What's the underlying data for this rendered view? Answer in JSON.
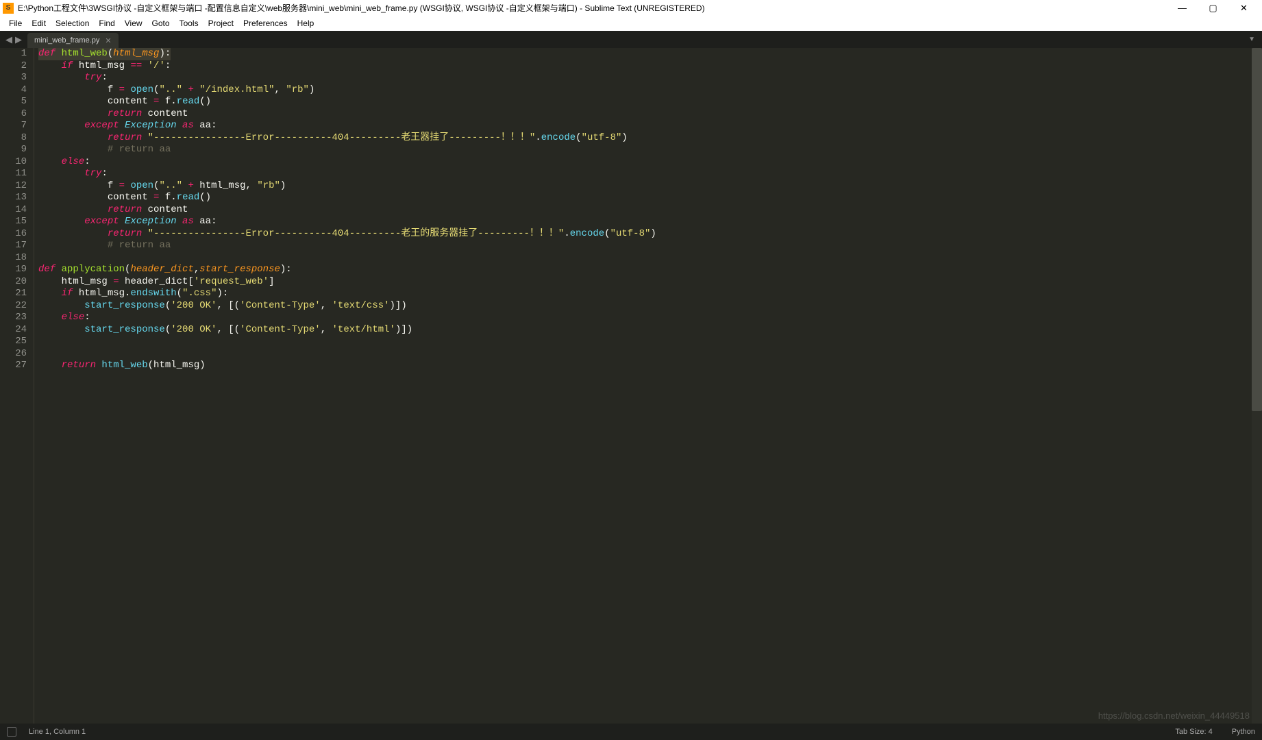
{
  "title": "E:\\Python工程文件\\3WSGI协议 -自定义框架与端口 -配置信息自定义\\web服务器\\mini_web\\mini_web_frame.py (WSGI协议, WSGI协议 -自定义框架与端口) - Sublime Text (UNREGISTERED)",
  "menu": [
    "File",
    "Edit",
    "Selection",
    "Find",
    "View",
    "Goto",
    "Tools",
    "Project",
    "Preferences",
    "Help"
  ],
  "tab": {
    "label": "mini_web_frame.py"
  },
  "lines": [
    "1",
    "2",
    "3",
    "4",
    "5",
    "6",
    "7",
    "8",
    "9",
    "10",
    "11",
    "12",
    "13",
    "14",
    "15",
    "16",
    "17",
    "18",
    "19",
    "20",
    "21",
    "22",
    "23",
    "24",
    "25",
    "26",
    "27"
  ],
  "status": {
    "pos": "Line 1, Column 1",
    "tabsize": "Tab Size: 4",
    "syntax": "Python"
  },
  "watermark": "https://blog.csdn.net/weixin_44449518",
  "code": {
    "l1": {
      "def": "def ",
      "fn": "html_web",
      "p": "html_msg"
    },
    "l2": {
      "if": "if ",
      "v": "html_msg",
      "op": " == ",
      "s": "'/'"
    },
    "l3": {
      "try": "try"
    },
    "l4": {
      "v": "f",
      "op": " = ",
      "call": "open",
      "s1": "\"..\"",
      "plus": " + ",
      "s2": "\"/index.html\"",
      "c": ", ",
      "s3": "\"rb\""
    },
    "l5": {
      "v": "content",
      "op": " = ",
      "obj": "f",
      "dot": ".",
      "call": "read"
    },
    "l6": {
      "ret": "return ",
      "v": "content"
    },
    "l7": {
      "exc": "except ",
      "cls": "Exception",
      "as": " as ",
      "v": "aa"
    },
    "l8": {
      "ret": "return ",
      "s": "\"----------------Error----------404---------老王器挂了---------！！！\"",
      "dot": ".",
      "call": "encode",
      "arg": "\"utf-8\""
    },
    "l9": {
      "cmt": "# return aa"
    },
    "l10": {
      "else": "else"
    },
    "l11": {
      "try": "try"
    },
    "l12": {
      "v": "f",
      "op": " = ",
      "call": "open",
      "s1": "\"..\"",
      "plus": " + ",
      "a": "html_msg",
      "c": ", ",
      "s3": "\"rb\""
    },
    "l13": {
      "v": "content",
      "op": " = ",
      "obj": "f",
      "dot": ".",
      "call": "read"
    },
    "l14": {
      "ret": "return ",
      "v": "content"
    },
    "l15": {
      "exc": "except ",
      "cls": "Exception",
      "as": " as ",
      "v": "aa"
    },
    "l16": {
      "ret": "return ",
      "s": "\"----------------Error----------404---------老王的服务器挂了---------！！！\"",
      "dot": ".",
      "call": "encode",
      "arg": "\"utf-8\""
    },
    "l17": {
      "cmt": "# return aa"
    },
    "l19": {
      "def": "def ",
      "fn": "applycation",
      "p1": "header_dict",
      "p2": "start_response"
    },
    "l20": {
      "v": "html_msg",
      "op": " = ",
      "obj": "header_dict",
      "idx": "'request_web'"
    },
    "l21": {
      "if": "if ",
      "obj": "html_msg",
      "dot": ".",
      "call": "endswith",
      "arg": "\".css\""
    },
    "l22": {
      "call": "start_response",
      "a1": "'200 OK'",
      "a2": "'Content-Type'",
      "a3": "'text/css'"
    },
    "l23": {
      "else": "else"
    },
    "l24": {
      "call": "start_response",
      "a1": "'200 OK'",
      "a2": "'Content-Type'",
      "a3": "'text/html'"
    },
    "l27": {
      "ret": "return ",
      "call": "html_web",
      "a": "html_msg"
    }
  }
}
